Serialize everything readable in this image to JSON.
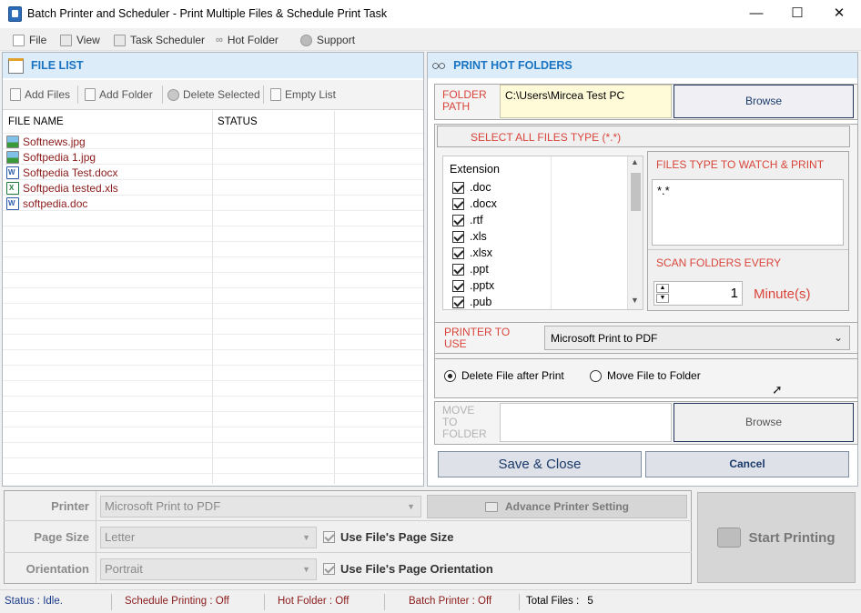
{
  "window": {
    "title": "Batch Printer and Scheduler - Print Multiple Files & Schedule Print Task",
    "min": "—",
    "max": "☐",
    "close": "✕"
  },
  "menu": [
    {
      "label": "File",
      "icon": "file-icon"
    },
    {
      "label": "View",
      "icon": "view-icon"
    },
    {
      "label": "Task Scheduler",
      "icon": "calendar-icon"
    },
    {
      "label": "Hot Folder",
      "icon": "glasses-icon"
    },
    {
      "label": "Support",
      "icon": "help-icon"
    }
  ],
  "file_list": {
    "title": "FILE LIST",
    "toolbar": {
      "add_files": "Add Files",
      "add_folder": "Add Folder",
      "delete_selected": "Delete Selected",
      "empty_list": "Empty List"
    },
    "columns": [
      "FILE NAME",
      "STATUS"
    ],
    "files": [
      {
        "name": "Softnews.jpg",
        "type": "image"
      },
      {
        "name": "Softpedia 1.jpg",
        "type": "image"
      },
      {
        "name": "Softpedia Test.docx",
        "type": "word"
      },
      {
        "name": "Softpedia tested.xls",
        "type": "excel"
      },
      {
        "name": "softpedia.doc",
        "type": "word"
      }
    ]
  },
  "hot_folders": {
    "title": "PRINT HOT FOLDERS",
    "folder_path_label": "FOLDER PATH",
    "folder_path_value": "C:\\Users\\Mircea Test PC",
    "browse_label": "Browse",
    "select_all_label": "SELECT ALL FILES TYPE (*.*)",
    "extension_header": "Extension",
    "extensions": [
      ".doc",
      ".docx",
      ".rtf",
      ".xls",
      ".xlsx",
      ".ppt",
      ".pptx",
      ".pub"
    ],
    "watch_label": "FILES TYPE TO WATCH & PRINT",
    "watch_value": "*.*",
    "scan_label": "SCAN FOLDERS EVERY",
    "scan_value": "1",
    "scan_unit": "Minute(s)",
    "printer_label": "PRINTER TO USE",
    "printer_value": "Microsoft Print to PDF",
    "radio_delete": "Delete File after Print",
    "radio_move": "Move File to Folder",
    "move_label": "MOVE TO FOLDER",
    "move_value": "",
    "browse2_label": "Browse",
    "save_close": "Save & Close",
    "cancel": "Cancel"
  },
  "bottom": {
    "printer_label": "Printer",
    "printer_value": "Microsoft Print to PDF",
    "advance_setting": "Advance Printer Setting",
    "page_size_label": "Page Size",
    "page_size_value": "Letter",
    "use_page_size": "Use File's Page Size",
    "orientation_label": "Orientation",
    "orientation_value": "Portrait",
    "use_orientation": "Use File's Page Orientation",
    "start_printing": "Start Printing"
  },
  "status": {
    "status": "Status : ",
    "status_value": "Idle.",
    "schedule": "Schedule Printing : Off",
    "hot_folder": "Hot Folder : Off",
    "batch": "Batch Printer : Off",
    "total": "Total Files : ",
    "total_value": "5"
  }
}
